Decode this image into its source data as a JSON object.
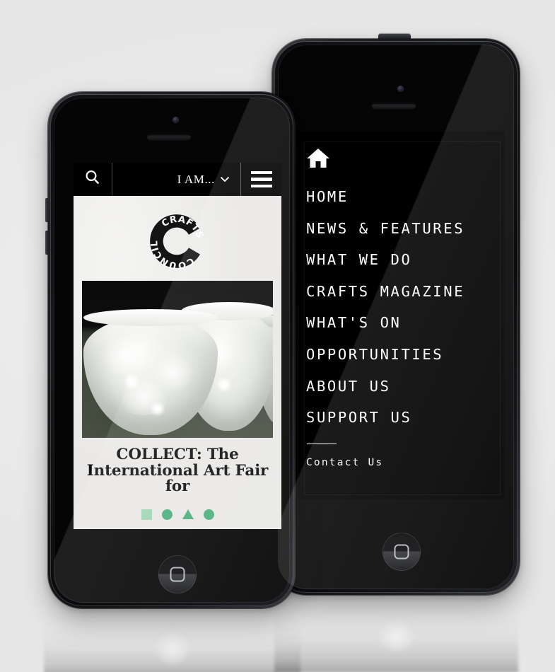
{
  "scene": {
    "background_color": "#ebebeb",
    "device_count": 2,
    "description": "Two iPhone mockups showing the Crafts Council responsive mobile website"
  },
  "back_phone": {
    "screen_name": "navigation-menu",
    "background_color": "#000000",
    "home_icon": "home-icon",
    "nav_items": [
      {
        "label": "HOME"
      },
      {
        "label": "NEWS & FEATURES"
      },
      {
        "label": "WHAT WE DO"
      },
      {
        "label": "CRAFTS MAGAZINE"
      },
      {
        "label": "WHAT'S ON"
      },
      {
        "label": "OPPORTUNITIES"
      },
      {
        "label": "ABOUT US"
      },
      {
        "label": "SUPPORT US"
      }
    ],
    "secondary_items": [
      {
        "label": "Contact Us"
      }
    ]
  },
  "front_phone": {
    "screen_name": "homepage",
    "topbar": {
      "search_icon": "search-icon",
      "audience_selector_label": "I AM...",
      "audience_selector_chevron": "chevron-down-icon",
      "menu_icon": "hamburger-menu-icon",
      "background_color": "#000000"
    },
    "logo": {
      "icon_name": "crafts-council-logo",
      "top_text": "CRAFTS",
      "bottom_text": "COUNCIL",
      "letter": "C"
    },
    "hero": {
      "image_alt": "Translucent white ceramic bowls on a dark background",
      "headline": "COLLECT: The International Art Fair for"
    },
    "carousel": {
      "accent_color": "#4caf7d",
      "muted_color": "#9ed6b3",
      "indicators": [
        {
          "shape": "square",
          "state": "inactive"
        },
        {
          "shape": "circle",
          "state": "active"
        },
        {
          "shape": "triangle",
          "state": "active"
        },
        {
          "shape": "circle",
          "state": "active"
        }
      ]
    },
    "page_background_color": "#e9e8e6"
  }
}
